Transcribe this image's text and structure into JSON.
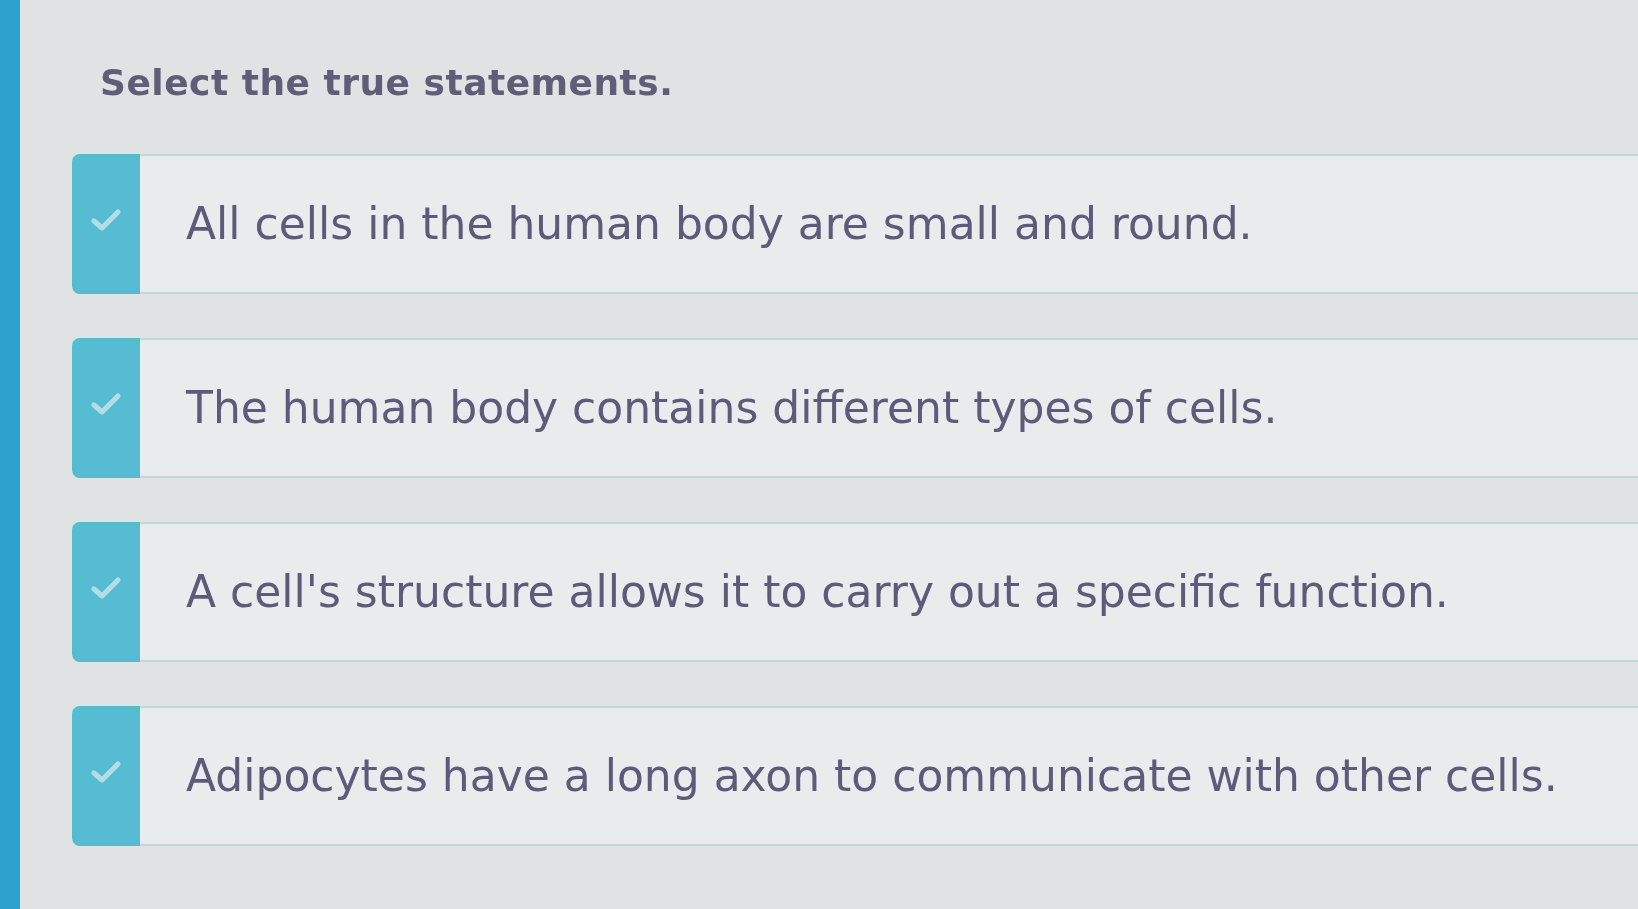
{
  "title": "Select the true statements.",
  "options": [
    {
      "text": "All cells in the human body are small and round.",
      "selected": false
    },
    {
      "text": "The human body contains different types of cells.",
      "selected": false
    },
    {
      "text": "A cell's structure allows it to carry out a specific function.",
      "selected": false
    },
    {
      "text": "Adipocytes have a long axon to communicate with other cells.",
      "selected": false
    }
  ]
}
